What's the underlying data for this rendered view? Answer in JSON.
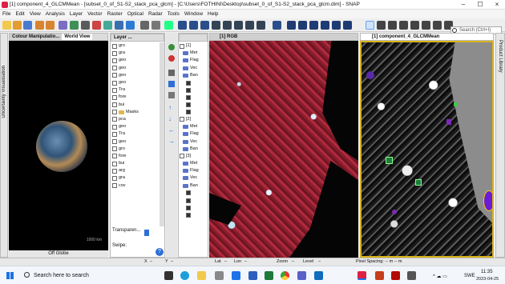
{
  "window": {
    "title": "[1] component_4_GLCMMean - [subset_0_of_S1-S2_stack_pca_glcm] - [C:\\Users\\FOTHINI\\Desktop\\subset_0_of_S1-S2_stack_pca_glcm.dim] - SNAP"
  },
  "menu": [
    "File",
    "Edit",
    "View",
    "Analysis",
    "Layer",
    "Vector",
    "Raster",
    "Optical",
    "Radar",
    "Tools",
    "Window",
    "Help"
  ],
  "search": {
    "placeholder": "Search (Ctrl+I)"
  },
  "left_panel": {
    "tab_colour": "Colour Manipulatio...",
    "tab_world": "World View",
    "side_tab": "Uncertainty Visualisation",
    "footer": "Off Globe",
    "scale": "1000 km"
  },
  "layer_panel": {
    "title": "Layer ...",
    "transparency_label": "Transparen...",
    "swipe_label": "Swipe:",
    "items": [
      "gro",
      "gra",
      "geo",
      "geo",
      "geo",
      "geo",
      "Tra",
      "fore",
      "bui",
      "Masks",
      "pca",
      "geo",
      "Tra",
      "geo",
      "gro",
      "fore",
      "bui",
      "arg",
      "gra",
      "cov"
    ]
  },
  "product_tree": {
    "items": [
      "[1]",
      "Met",
      "Flag",
      "Vec",
      "Ban",
      "[2]",
      "Met",
      "Flag",
      "Vec",
      "Ban",
      "[3]",
      "Met",
      "Flag",
      "Vec",
      "Ban"
    ]
  },
  "views": {
    "rgb_tab": "[1] RGB",
    "glcm_tab": "[1] component_4_GLCMMean",
    "right_side_tab": "Product Library"
  },
  "status_bar": {
    "x": "X",
    "y": "Y",
    "lat": "Lat",
    "lon": "Lon",
    "zoom": "Zoom",
    "level": "Level",
    "pixel_spacing": "Pixel Spacing: -- m -- m"
  },
  "taskbar": {
    "search": "Search here to search",
    "clock_time": "11:35",
    "clock_date": "2023-04-25",
    "lang": "SWE"
  }
}
